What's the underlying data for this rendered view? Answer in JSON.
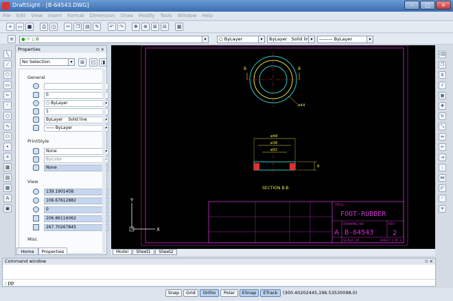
{
  "app": {
    "title": "DraftSight - [B-64543.DWG]"
  },
  "menu": [
    "File",
    "Edit",
    "View",
    "Insert",
    "Format",
    "Dimension",
    "Draw",
    "Modify",
    "Tools",
    "Window",
    "Help"
  ],
  "toolbar2": {
    "layer_value": "0",
    "color": "ByLayer",
    "linestyle_layer": "ByLayer",
    "linestyle": "Solid line",
    "lineweight": "ByLayer"
  },
  "properties": {
    "title": "Properties",
    "selection": "No Selection",
    "general_label": "General",
    "general": {
      "layer": "0",
      "color": "ByLayer",
      "scale": "1",
      "linestyle_layer": "ByLayer",
      "linestyle": "Solid line",
      "lineweight": "ByLayer"
    },
    "printstyle_label": "PrintStyle",
    "printstyle": {
      "style": "None",
      "color": "ByColor",
      "table": "None"
    },
    "view_label": "View",
    "view": [
      "139.1901458",
      "106.67612882",
      "0",
      "206.86116062",
      "267.70267845"
    ],
    "misc_label": "Misc",
    "tabs": [
      "Home",
      "Properties"
    ]
  },
  "drawing": {
    "title_label": "TITLE:",
    "title": "FOOT-RUBBER",
    "drawing_no_label": "DRAWING NO",
    "drawing_no": "B-64543",
    "rev_label": "REV",
    "rev": "2",
    "size": "A",
    "sheet": "SHEET 1 OF 1",
    "scale": "SCALE: 2X",
    "section_label": "SECTION B-B",
    "dim_dia44": "ø44",
    "dim_dia48": "ø48",
    "dim_dia36": "ø36",
    "dim_dia32": "ø32",
    "dim_8": "8",
    "mark_b": "B",
    "axis_y": "Y",
    "axis_x": "X"
  },
  "sheets": [
    "Model",
    "Sheet1",
    "Sheet2"
  ],
  "command": {
    "title": "Command window",
    "prompt": ": pp"
  },
  "status": {
    "buttons": [
      "Snap",
      "Grid",
      "Ortho",
      "Polar",
      "ESnap",
      "ETrack"
    ],
    "coords": "(300.40202445,196.53530098,0)"
  },
  "colors": {
    "magenta": "#cc33cc",
    "cyan": "#33cccc",
    "yellow": "#e8e83a",
    "red": "#e03030"
  }
}
